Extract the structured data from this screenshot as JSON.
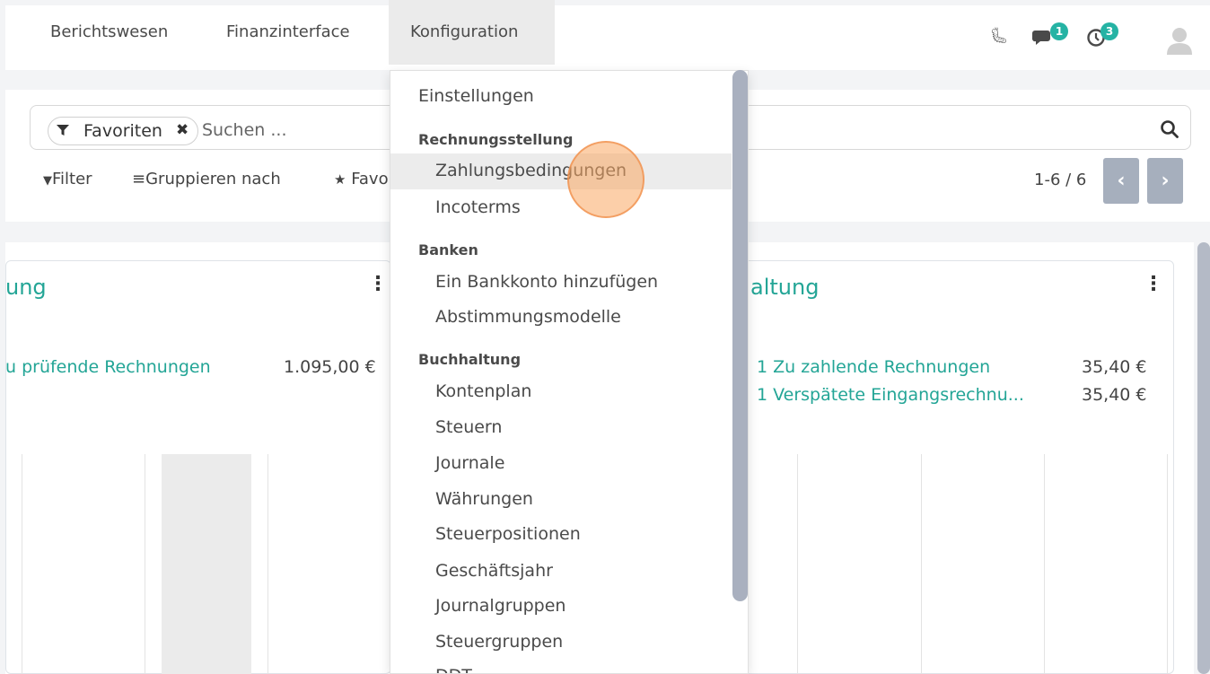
{
  "nav": {
    "items": [
      "Berichtswesen",
      "Finanzinterface",
      "Konfiguration"
    ],
    "chat_count": "1",
    "activity_count": "3"
  },
  "search": {
    "facet_label": "Favoriten",
    "placeholder": "Suchen ..."
  },
  "toolbar": {
    "filter": "Filter",
    "groupby": "Gruppieren nach",
    "favorites_partial": "Favo"
  },
  "pager": {
    "value": "1-6 / 6"
  },
  "cards": [
    {
      "title": "ung",
      "rows": [
        {
          "label": "u prüfende Rechnungen",
          "amount": "1.095,00 €"
        }
      ]
    },
    {
      "title": "altung",
      "rows": [
        {
          "label": "1 Zu zahlende Rechnungen",
          "amount": "35,40 €"
        },
        {
          "label": "1 Verspätete Eingangsrechnu...",
          "amount": "35,40 €"
        }
      ]
    }
  ],
  "menu": {
    "einstellungen": "Einstellungen",
    "sections": [
      {
        "header": "Rechnungsstellung",
        "items": [
          "Zahlungsbedingungen",
          "Incoterms"
        ]
      },
      {
        "header": "Banken",
        "items": [
          "Ein Bankkonto hinzufügen",
          "Abstimmungsmodelle"
        ]
      },
      {
        "header": "Buchhaltung",
        "items": [
          "Kontenplan",
          "Steuern",
          "Journale",
          "Währungen",
          "Steuerpositionen",
          "Geschäftsjahr",
          "Journalgruppen",
          "Steuergruppen",
          "DDT"
        ]
      }
    ]
  },
  "colors": {
    "accent": "#23a596",
    "badge": "#25b3a4",
    "pager_button": "#a6afbd"
  }
}
